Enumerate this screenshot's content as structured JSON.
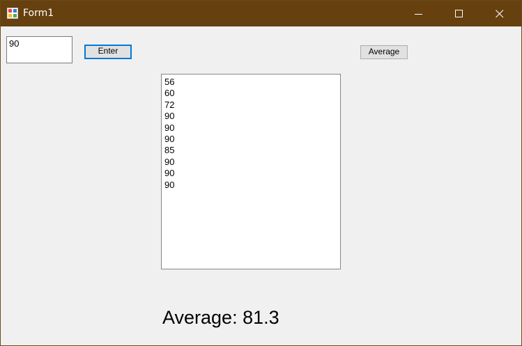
{
  "window": {
    "title": "Form1",
    "titlebar_color": "#66400f"
  },
  "icons": {
    "app": "form-app-icon",
    "minimize": "minimize-icon",
    "maximize": "maximize-icon",
    "close": "close-icon"
  },
  "input": {
    "value": "90"
  },
  "buttons": {
    "enter_label": "Enter",
    "average_label": "Average"
  },
  "listbox": {
    "items": [
      "56",
      "60",
      "72",
      "90",
      "90",
      "90",
      "85",
      "90",
      "90",
      "90"
    ]
  },
  "result": {
    "average_text": "Average: 81.3"
  }
}
